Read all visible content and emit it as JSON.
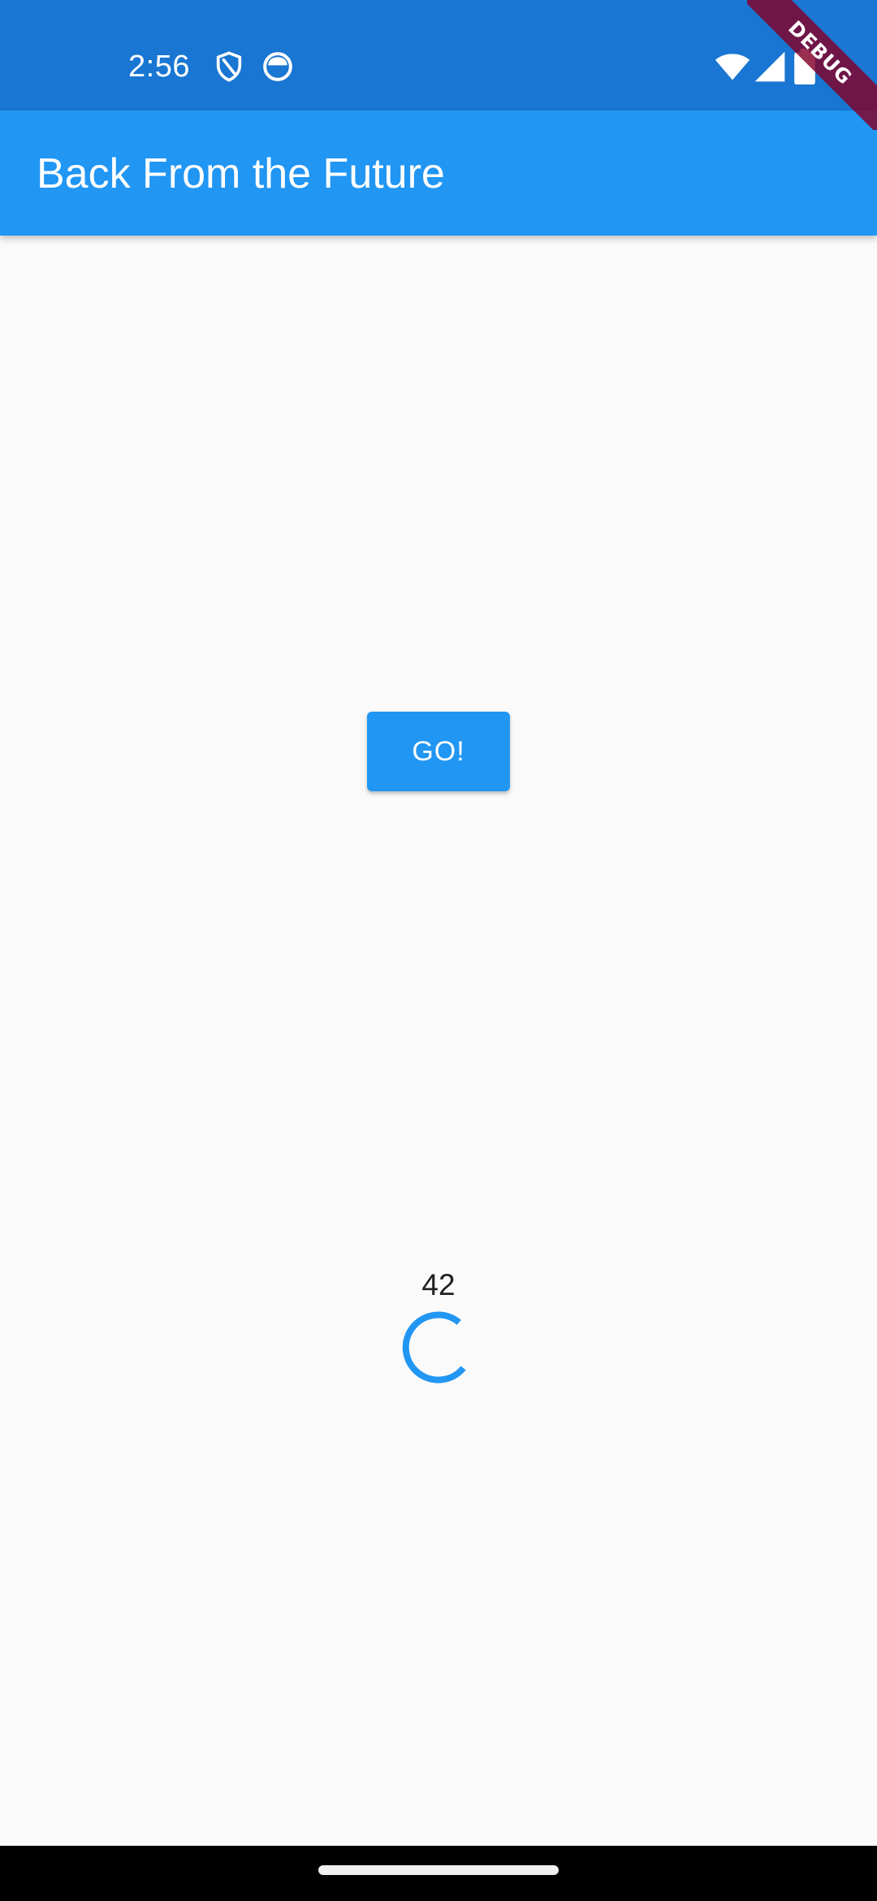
{
  "status_bar": {
    "time": "2:56",
    "left_icons": [
      "shield-icon",
      "app-notification-icon"
    ],
    "right_icons": [
      "wifi-icon",
      "cell-signal-icon",
      "battery-icon"
    ]
  },
  "debug_banner": {
    "label": "DEBUG"
  },
  "app_bar": {
    "title": "Back From the Future",
    "color": "#2196f3"
  },
  "main": {
    "go_button_label": "GO!",
    "result_value": "42",
    "loading_indicator": "circular-progress-icon"
  },
  "colors": {
    "primary": "#2196f3",
    "status_bar": "#1976d2",
    "background": "#fafafa"
  }
}
